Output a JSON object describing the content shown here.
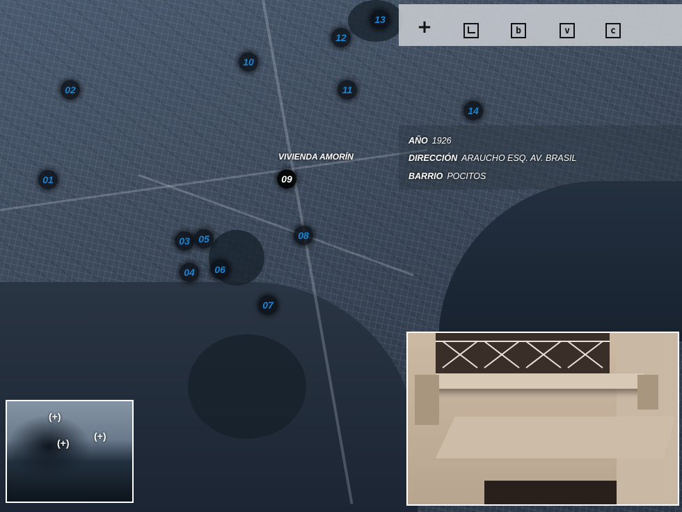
{
  "toolbar": {
    "plus_label": "+",
    "buttons": [
      {
        "label": "",
        "icon": "corner-arrow-icon"
      },
      {
        "label": "b"
      },
      {
        "label": "v"
      },
      {
        "label": "c"
      }
    ]
  },
  "markers": [
    "01",
    "02",
    "03",
    "04",
    "05",
    "06",
    "07",
    "08",
    "09",
    "10",
    "11",
    "12",
    "13",
    "14"
  ],
  "selected": {
    "title": "VIVIENDA AMORÍN",
    "marker": "09",
    "year_key": "AÑO",
    "year_value": "1926",
    "address_key": "DIRECCIÓN",
    "address_value": "ARAUCHO ESQ. AV. BRASIL",
    "district_key": "BARRIO",
    "district_value": "POCITOS"
  },
  "minimap": {
    "labels": [
      "(+)",
      "(+)",
      "(+)"
    ]
  },
  "colors": {
    "marker_text": "#1a84d4",
    "active_marker_text": "#ffffff",
    "toolbar_bg": "#c8ccd2"
  }
}
